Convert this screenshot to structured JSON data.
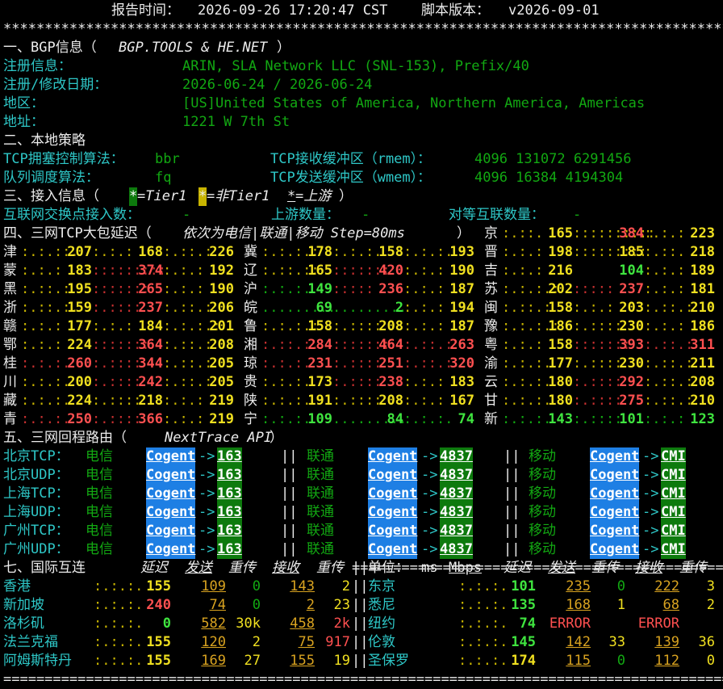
{
  "header": {
    "time_label": "报告时间：",
    "time": "2026-09-26 17:20:47 CST",
    "ver_label": "脚本版本：",
    "version": "v2026-09-01",
    "stars": "**********************************************************************************************",
    "footer": "=============================================================================================="
  },
  "bgp": {
    "title": "一、BGP信息（",
    "source": "BGP.TOOLS & HE.NET",
    "title_end": "）",
    "rows": [
      {
        "k": "注册信息：",
        "v": "ARIN, SLA Network LLC (SNL-153), Prefix/40"
      },
      {
        "k": "注册/修改日期：",
        "v": "2026-06-24 / 2026-06-24"
      },
      {
        "k": "地区：",
        "v": "[US]United States of America, Northern America, Americas"
      },
      {
        "k": "地址：",
        "v": "1221 W 7th St"
      }
    ]
  },
  "policy": {
    "title": "二、本地策略",
    "cc_k": "TCP拥塞控制算法：",
    "cc_v": "bbr",
    "rmem_k": "TCP接收缓冲区（rmem）：",
    "rmem_v": "4096 131072 6291456",
    "qd_k": "队列调度算法：",
    "qd_v": "fq",
    "wmem_k": "TCP发送缓冲区（wmem）：",
    "wmem_v": "4096 16384 4194304"
  },
  "access": {
    "title": "三、接入信息（",
    "t1": "*",
    "t1_lbl": "=Tier1 ",
    "t2": "*",
    "t2_lbl": "=非Tier1 ",
    "up": "*",
    "up_lbl": "=上游",
    "title_end": "）",
    "ix_k": "互联网交换点接入数：",
    "ix_v": "-",
    "up_k": "上游数量：",
    "up_v": "-",
    "peer_k": "对等互联数量：",
    "peer_v": "-"
  },
  "latency": {
    "title": "四、三网TCP大包延迟（",
    "desc": "依次为电信|联通|移动 Step=80ms",
    "title_end": "）",
    "cells": [
      {
        "p": "京",
        "v": [
          "",
          "165",
          "384",
          "223"
        ],
        "f": [
          "y",
          "y",
          "rd",
          "y"
        ],
        "m": [
          ":.",
          ":.::.",
          "::::::::::",
          ":.:.:"
        ]
      },
      {
        "p": "津",
        "v": [
          "207",
          "168",
          "226"
        ],
        "m": [
          ":.:.::.",
          ":.:.:",
          ":.::.:"
        ]
      },
      {
        "p": "冀",
        "v": [
          "178",
          "158",
          "193"
        ],
        "m": [
          ":.:.:.:",
          ":.:.:.",
          ":.:.:."
        ]
      },
      {
        "p": "晋",
        "v": [
          "198",
          "185",
          "218"
        ],
        "m": [
          ":.:.:",
          ":::::::::",
          ":.::."
        ]
      },
      {
        "p": "蒙",
        "v": [
          "183",
          "374",
          "192"
        ],
        "m": [
          ":.:.:",
          ":::::::::",
          ":.:.:"
        ]
      },
      {
        "p": "辽",
        "v": [
          "165",
          "420",
          "190"
        ],
        "m": [
          ":.::.::",
          ":::::::",
          ":.:.:"
        ]
      },
      {
        "p": "吉",
        "v": [
          "216",
          "104",
          "189"
        ],
        "m": [
          ":.:.:",
          "",
          ":.:.:"
        ]
      },
      {
        "p": "黑",
        "v": [
          "195",
          "265",
          "190"
        ],
        "m": [
          ":.::.:",
          ":::::::",
          ":.:.:"
        ]
      },
      {
        "p": "沪",
        "v": [
          "149",
          "236",
          "187"
        ],
        "m": [
          ":.:.:.",
          ":::::",
          ":.:.:"
        ]
      },
      {
        "p": "苏",
        "v": [
          "202",
          "237",
          "181"
        ],
        "m": [
          ":.:.:.:",
          ":::::",
          ":.:.:"
        ]
      },
      {
        "p": "浙",
        "v": [
          "159",
          "237",
          "206"
        ],
        "m": [
          ":.::.:.",
          ":.::::",
          ":.::.:"
        ]
      },
      {
        "p": "皖",
        "v": [
          "69",
          "2",
          "194"
        ],
        "m": [
          ".........",
          ".........",
          ":.:.:"
        ]
      },
      {
        "p": "闽",
        "v": [
          "158",
          "203",
          "210"
        ],
        "m": [
          ":.::.:",
          ":.:.:",
          ":.::.:"
        ]
      },
      {
        "p": "赣",
        "v": [
          "177",
          "184",
          "201"
        ],
        "m": [
          ":.:.:",
          ":.:.:",
          ":.:.:.:"
        ]
      },
      {
        "p": "鲁",
        "v": [
          "158",
          "208",
          "187"
        ],
        "m": [
          ":.:.:.:",
          ":.::::",
          ":.:.:"
        ]
      },
      {
        "p": "豫",
        "v": [
          "186",
          "230",
          "186"
        ],
        "m": [
          ":.:.:.:",
          ":.::::",
          ":.:.:"
        ]
      },
      {
        "p": "鄂",
        "v": [
          "224",
          "364",
          "208"
        ],
        "m": [
          ":.:.:",
          ":::::::",
          ":.::.:"
        ]
      },
      {
        "p": "湘",
        "v": [
          "284",
          "464",
          "263"
        ],
        "m": [
          ":.::.:.",
          ":::::::",
          ":.::.:"
        ]
      },
      {
        "p": "粤",
        "v": [
          "158",
          "393",
          "311"
        ],
        "m": [
          ":.:.:",
          ":::::::",
          ":.::.:"
        ]
      },
      {
        "p": "桂",
        "v": [
          "260",
          "344",
          "205"
        ],
        "m": [
          ":.:.:.",
          ":.::::",
          ":.::.:"
        ]
      },
      {
        "p": "琼",
        "v": [
          "231",
          "251",
          "320"
        ],
        "m": [
          ":.:.:.",
          ":.::::",
          ":.::.:"
        ]
      },
      {
        "p": "渝",
        "v": [
          "177",
          "230",
          "211"
        ],
        "m": [
          ":.:.:.",
          ":.::::",
          ":.::.:"
        ]
      },
      {
        "p": "川",
        "v": [
          "200",
          "242",
          "205"
        ],
        "m": [
          ":.:.:.",
          ":.::::",
          ":.::.:"
        ]
      },
      {
        "p": "贵",
        "v": [
          "173",
          "238",
          "183"
        ],
        "m": [
          ":.:.:.",
          ":.::::",
          ":.:.:"
        ]
      },
      {
        "p": "云",
        "v": [
          "180",
          "292",
          "208"
        ],
        "m": [
          ":.:.:.",
          ":.::::",
          ":.::.:"
        ]
      },
      {
        "p": "藏",
        "v": [
          "224",
          "218",
          "219"
        ],
        "m": [
          ":.:.:.",
          ":.::::",
          ":.:.:"
        ]
      },
      {
        "p": "陕",
        "v": [
          "191",
          "208",
          "167"
        ],
        "m": [
          ":.:.:.",
          ":.::::",
          ":.:.:"
        ]
      },
      {
        "p": "甘",
        "v": [
          "180",
          "275",
          "210"
        ],
        "m": [
          ":.:.:.",
          ":.::::",
          ":.::.:"
        ]
      },
      {
        "p": "青",
        "v": [
          "250",
          "366",
          "219"
        ],
        "m": [
          ":.:.:.",
          ":.::::",
          ":.:.:"
        ]
      },
      {
        "p": "宁",
        "v": [
          "109",
          "84",
          "74"
        ],
        "m": [
          ":.:.:.",
          ".........",
          ":.:.:."
        ]
      },
      {
        "p": "新",
        "v": [
          "143",
          "101",
          "123"
        ],
        "m": [
          ":.:.:.",
          ":.::::",
          ":.:.:"
        ]
      }
    ]
  },
  "route": {
    "title": "五、三网回程路由（",
    "api": "NextTrace API",
    "title_end": "）",
    "rows": [
      {
        "k": "北京TCP：",
        "t": "电信"
      },
      {
        "k": "北京UDP：",
        "t": "电信"
      },
      {
        "k": "上海TCP：",
        "t": "电信"
      },
      {
        "k": "上海UDP：",
        "t": "电信"
      },
      {
        "k": "广州TCP：",
        "t": "电信"
      },
      {
        "k": "广州UDP：",
        "t": "电信"
      }
    ],
    "u": "联通",
    "m": "移动",
    "cogent": "Cogent",
    "arrow": "->",
    "asn_t": "163",
    "asn_u": "4837",
    "asn_m": "CMI",
    "sep": "||"
  },
  "intl": {
    "title": "七、国际互连",
    "h_delay": "延迟",
    "h_send": "发送",
    "h_retx": "重传",
    "h_recv": "接收",
    "h_retx2": "重传",
    "unit_k": "单位：",
    "unit_ms": "ms",
    "unit_mbps": "Mbps",
    "left": [
      {
        "n": "香港",
        "d": "155",
        "s": "109",
        "r": "0",
        "rv": "143",
        "r2": "2"
      },
      {
        "n": "新加坡",
        "d": "240",
        "s": "74",
        "r": "0",
        "rv": "2",
        "r2": "23"
      },
      {
        "n": "洛杉矶",
        "d": "0",
        "s": "582",
        "r": "30k",
        "rv": "458",
        "r2": "2k"
      },
      {
        "n": "法兰克福",
        "d": "155",
        "s": "120",
        "r": "2",
        "rv": "75",
        "r2": "917"
      },
      {
        "n": "阿姆斯特丹",
        "d": "155",
        "s": "169",
        "r": "27",
        "rv": "155",
        "r2": "19"
      }
    ],
    "right": [
      {
        "n": "东京",
        "d": "101",
        "s": "235",
        "r": "0",
        "rv": "222",
        "r2": "3"
      },
      {
        "n": "悉尼",
        "d": "135",
        "s": "168",
        "r": "1",
        "rv": "68",
        "r2": "2"
      },
      {
        "n": "纽约",
        "d": "74",
        "s": "ERROR",
        "r": "",
        "rv": "ERROR",
        "r2": ""
      },
      {
        "n": "伦敦",
        "d": "145",
        "s": "142",
        "r": "33",
        "rv": "139",
        "r2": "36"
      },
      {
        "n": "圣保罗",
        "d": "174",
        "s": "115",
        "r": "0",
        "rv": "112",
        "r2": "0"
      }
    ]
  }
}
